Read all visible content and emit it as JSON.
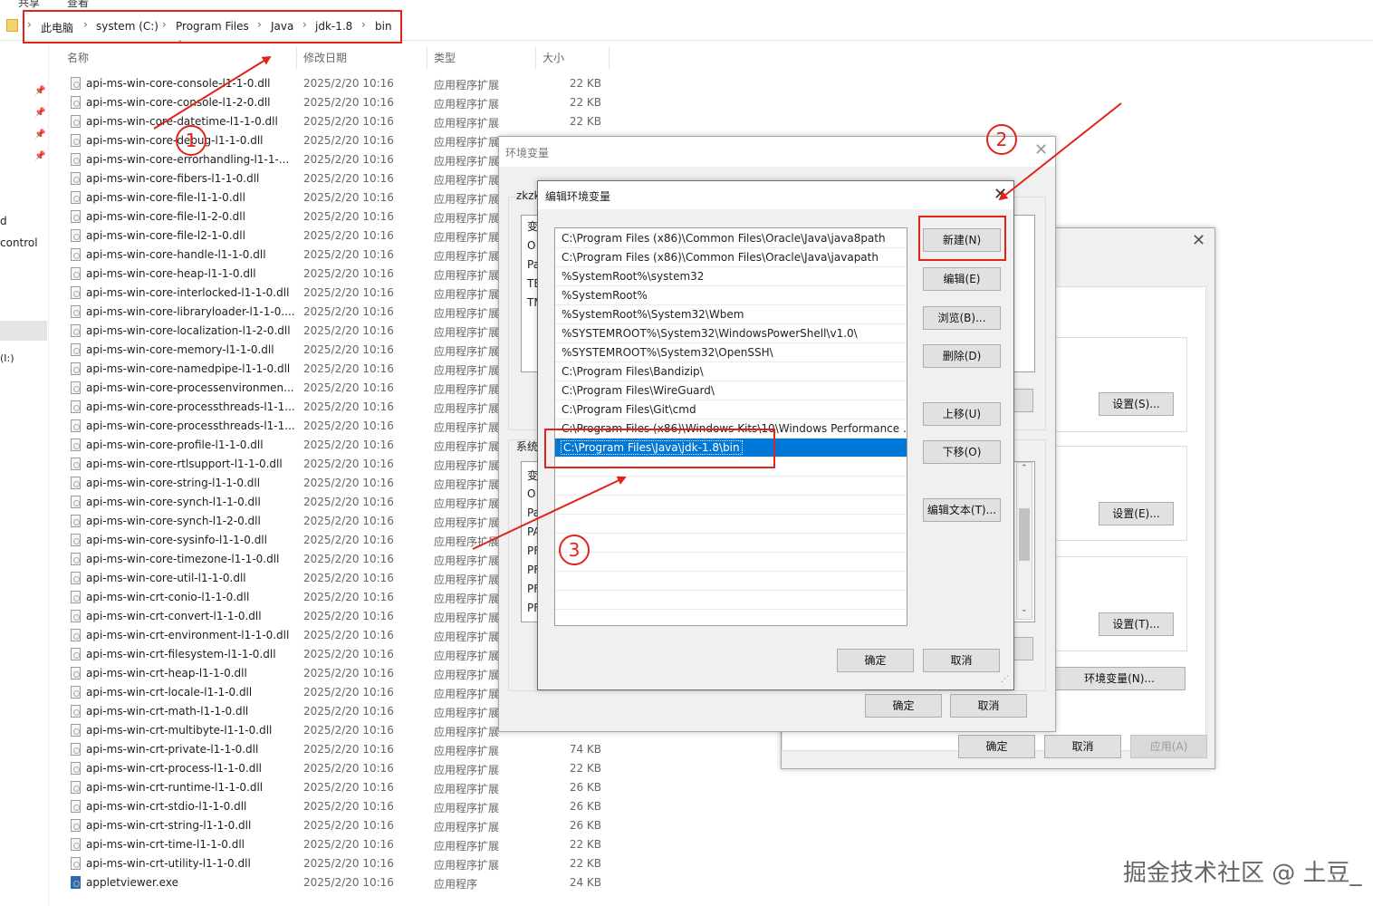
{
  "explorer": {
    "menu": [
      "共享",
      "查看"
    ],
    "breadcrumb": [
      "此电脑",
      "system (C:)",
      "Program Files",
      "Java",
      "jdk-1.8",
      "bin"
    ],
    "columns": {
      "name": "名称",
      "date": "修改日期",
      "type": "类型",
      "size": "大小"
    },
    "nav_labels": [
      "d",
      "control",
      "(I:)"
    ],
    "files": [
      {
        "name": "api-ms-win-core-console-l1-1-0.dll",
        "date": "2025/2/20 10:16",
        "type": "应用程序扩展",
        "size": "22 KB"
      },
      {
        "name": "api-ms-win-core-console-l1-2-0.dll",
        "date": "2025/2/20 10:16",
        "type": "应用程序扩展",
        "size": "22 KB"
      },
      {
        "name": "api-ms-win-core-datetime-l1-1-0.dll",
        "date": "2025/2/20 10:16",
        "type": "应用程序扩展",
        "size": "22 KB"
      },
      {
        "name": "api-ms-win-core-debug-l1-1-0.dll",
        "date": "2025/2/20 10:16",
        "type": "应用程序扩展",
        "size": ""
      },
      {
        "name": "api-ms-win-core-errorhandling-l1-1-...",
        "date": "2025/2/20 10:16",
        "type": "应用程序扩展",
        "size": ""
      },
      {
        "name": "api-ms-win-core-fibers-l1-1-0.dll",
        "date": "2025/2/20 10:16",
        "type": "应用程序扩展",
        "size": ""
      },
      {
        "name": "api-ms-win-core-file-l1-1-0.dll",
        "date": "2025/2/20 10:16",
        "type": "应用程序扩展",
        "size": ""
      },
      {
        "name": "api-ms-win-core-file-l1-2-0.dll",
        "date": "2025/2/20 10:16",
        "type": "应用程序扩展",
        "size": ""
      },
      {
        "name": "api-ms-win-core-file-l2-1-0.dll",
        "date": "2025/2/20 10:16",
        "type": "应用程序扩展",
        "size": ""
      },
      {
        "name": "api-ms-win-core-handle-l1-1-0.dll",
        "date": "2025/2/20 10:16",
        "type": "应用程序扩展",
        "size": ""
      },
      {
        "name": "api-ms-win-core-heap-l1-1-0.dll",
        "date": "2025/2/20 10:16",
        "type": "应用程序扩展",
        "size": ""
      },
      {
        "name": "api-ms-win-core-interlocked-l1-1-0.dll",
        "date": "2025/2/20 10:16",
        "type": "应用程序扩展",
        "size": ""
      },
      {
        "name": "api-ms-win-core-libraryloader-l1-1-0....",
        "date": "2025/2/20 10:16",
        "type": "应用程序扩展",
        "size": ""
      },
      {
        "name": "api-ms-win-core-localization-l1-2-0.dll",
        "date": "2025/2/20 10:16",
        "type": "应用程序扩展",
        "size": ""
      },
      {
        "name": "api-ms-win-core-memory-l1-1-0.dll",
        "date": "2025/2/20 10:16",
        "type": "应用程序扩展",
        "size": ""
      },
      {
        "name": "api-ms-win-core-namedpipe-l1-1-0.dll",
        "date": "2025/2/20 10:16",
        "type": "应用程序扩展",
        "size": ""
      },
      {
        "name": "api-ms-win-core-processenvironmen...",
        "date": "2025/2/20 10:16",
        "type": "应用程序扩展",
        "size": ""
      },
      {
        "name": "api-ms-win-core-processthreads-l1-1...",
        "date": "2025/2/20 10:16",
        "type": "应用程序扩展",
        "size": ""
      },
      {
        "name": "api-ms-win-core-processthreads-l1-1...",
        "date": "2025/2/20 10:16",
        "type": "应用程序扩展",
        "size": ""
      },
      {
        "name": "api-ms-win-core-profile-l1-1-0.dll",
        "date": "2025/2/20 10:16",
        "type": "应用程序扩展",
        "size": ""
      },
      {
        "name": "api-ms-win-core-rtlsupport-l1-1-0.dll",
        "date": "2025/2/20 10:16",
        "type": "应用程序扩展",
        "size": ""
      },
      {
        "name": "api-ms-win-core-string-l1-1-0.dll",
        "date": "2025/2/20 10:16",
        "type": "应用程序扩展",
        "size": ""
      },
      {
        "name": "api-ms-win-core-synch-l1-1-0.dll",
        "date": "2025/2/20 10:16",
        "type": "应用程序扩展",
        "size": ""
      },
      {
        "name": "api-ms-win-core-synch-l1-2-0.dll",
        "date": "2025/2/20 10:16",
        "type": "应用程序扩展",
        "size": ""
      },
      {
        "name": "api-ms-win-core-sysinfo-l1-1-0.dll",
        "date": "2025/2/20 10:16",
        "type": "应用程序扩展",
        "size": ""
      },
      {
        "name": "api-ms-win-core-timezone-l1-1-0.dll",
        "date": "2025/2/20 10:16",
        "type": "应用程序扩展",
        "size": ""
      },
      {
        "name": "api-ms-win-core-util-l1-1-0.dll",
        "date": "2025/2/20 10:16",
        "type": "应用程序扩展",
        "size": ""
      },
      {
        "name": "api-ms-win-crt-conio-l1-1-0.dll",
        "date": "2025/2/20 10:16",
        "type": "应用程序扩展",
        "size": ""
      },
      {
        "name": "api-ms-win-crt-convert-l1-1-0.dll",
        "date": "2025/2/20 10:16",
        "type": "应用程序扩展",
        "size": ""
      },
      {
        "name": "api-ms-win-crt-environment-l1-1-0.dll",
        "date": "2025/2/20 10:16",
        "type": "应用程序扩展",
        "size": ""
      },
      {
        "name": "api-ms-win-crt-filesystem-l1-1-0.dll",
        "date": "2025/2/20 10:16",
        "type": "应用程序扩展",
        "size": ""
      },
      {
        "name": "api-ms-win-crt-heap-l1-1-0.dll",
        "date": "2025/2/20 10:16",
        "type": "应用程序扩展",
        "size": ""
      },
      {
        "name": "api-ms-win-crt-locale-l1-1-0.dll",
        "date": "2025/2/20 10:16",
        "type": "应用程序扩展",
        "size": ""
      },
      {
        "name": "api-ms-win-crt-math-l1-1-0.dll",
        "date": "2025/2/20 10:16",
        "type": "应用程序扩展",
        "size": ""
      },
      {
        "name": "api-ms-win-crt-multibyte-l1-1-0.dll",
        "date": "2025/2/20 10:16",
        "type": "应用程序扩展",
        "size": ""
      },
      {
        "name": "api-ms-win-crt-private-l1-1-0.dll",
        "date": "2025/2/20 10:16",
        "type": "应用程序扩展",
        "size": "74 KB"
      },
      {
        "name": "api-ms-win-crt-process-l1-1-0.dll",
        "date": "2025/2/20 10:16",
        "type": "应用程序扩展",
        "size": "22 KB"
      },
      {
        "name": "api-ms-win-crt-runtime-l1-1-0.dll",
        "date": "2025/2/20 10:16",
        "type": "应用程序扩展",
        "size": "26 KB"
      },
      {
        "name": "api-ms-win-crt-stdio-l1-1-0.dll",
        "date": "2025/2/20 10:16",
        "type": "应用程序扩展",
        "size": "26 KB"
      },
      {
        "name": "api-ms-win-crt-string-l1-1-0.dll",
        "date": "2025/2/20 10:16",
        "type": "应用程序扩展",
        "size": "26 KB"
      },
      {
        "name": "api-ms-win-crt-time-l1-1-0.dll",
        "date": "2025/2/20 10:16",
        "type": "应用程序扩展",
        "size": "22 KB"
      },
      {
        "name": "api-ms-win-crt-utility-l1-1-0.dll",
        "date": "2025/2/20 10:16",
        "type": "应用程序扩展",
        "size": "22 KB"
      },
      {
        "name": "appletviewer.exe",
        "date": "2025/2/20 10:16",
        "type": "应用程序",
        "size": "24 KB"
      }
    ]
  },
  "sysprops": {
    "buttons": [
      "设置(S)...",
      "设置(E)...",
      "设置(T)...",
      "环境变量(N)..."
    ],
    "footer": {
      "ok": "确定",
      "cancel": "取消",
      "apply": "应用(A)"
    }
  },
  "envvars": {
    "title": "环境变量",
    "user_prefix": "zkzk",
    "system_label": "系统",
    "user_col": "变",
    "user_rows": [
      "O",
      "Pa",
      "TE",
      "TM"
    ],
    "sys_col": "变",
    "sys_rows": [
      "O",
      "Pa",
      "PA",
      "PF",
      "PF",
      "PF",
      "PF"
    ],
    "ok": "确定",
    "cancel": "取消"
  },
  "editenv": {
    "title": "编辑环境变量",
    "paths": [
      "C:\\Program Files (x86)\\Common Files\\Oracle\\Java\\java8path",
      "C:\\Program Files (x86)\\Common Files\\Oracle\\Java\\javapath",
      "%SystemRoot%\\system32",
      "%SystemRoot%",
      "%SystemRoot%\\System32\\Wbem",
      "%SYSTEMROOT%\\System32\\WindowsPowerShell\\v1.0\\",
      "%SYSTEMROOT%\\System32\\OpenSSH\\",
      "C:\\Program Files\\Bandizip\\",
      "C:\\Program Files\\WireGuard\\",
      "C:\\Program Files\\Git\\cmd",
      "C:\\Program Files (x86)\\Windows Kits\\10\\Windows Performance ...",
      "C:\\Program Files\\Java\\jdk-1.8\\bin"
    ],
    "selected_index": 11,
    "buttons": {
      "new": "新建(N)",
      "edit": "编辑(E)",
      "browse": "浏览(B)...",
      "delete": "删除(D)",
      "up": "上移(U)",
      "down": "下移(O)",
      "edit_text": "编辑文本(T)..."
    },
    "ok": "确定",
    "cancel": "取消"
  },
  "annotations": {
    "step1": "1",
    "step2": "2",
    "step3": "3",
    "color": "#e2231a"
  },
  "watermark": "掘金技术社区 @ 土豆_"
}
